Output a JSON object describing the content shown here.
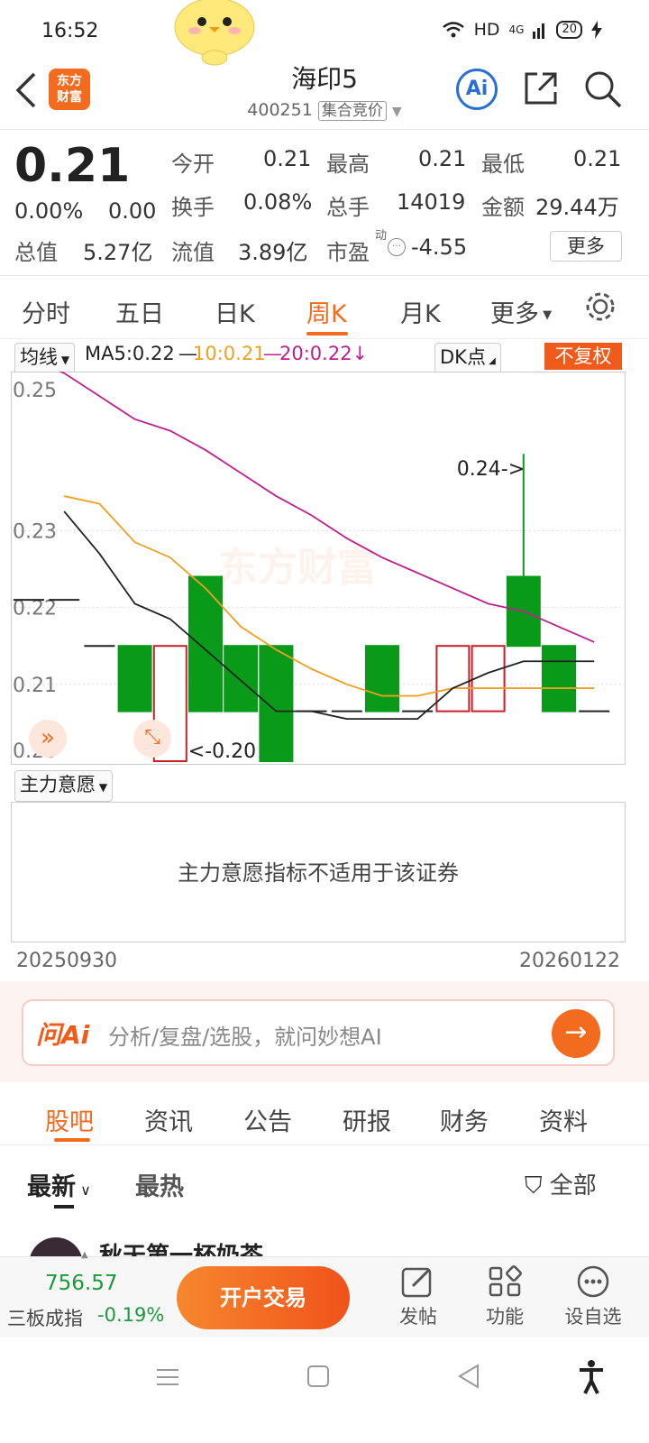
{
  "status": {
    "time": "16:52",
    "hd": "HD",
    "net": "4G",
    "battery": "20"
  },
  "header": {
    "title": "海印5",
    "code": "400251",
    "auction": "集合竞价",
    "logo_line1": "东方",
    "logo_line2": "财富",
    "ai_label": "Ai"
  },
  "quote": {
    "price": "0.21",
    "change_pct": "0.00%",
    "change": "0.00",
    "open_label": "今开",
    "open": "0.21",
    "high_label": "最高",
    "high": "0.21",
    "low_label": "最低",
    "low": "0.21",
    "turnover_label": "换手",
    "turnover": "0.08%",
    "volume_label": "总手",
    "volume": "14019",
    "amount_label": "金额",
    "amount": "29.44万",
    "mcap_label": "总值",
    "mcap": "5.27亿",
    "float_label": "流值",
    "float_cap": "3.89亿",
    "pe_label": "市盈",
    "pe_sup": "动",
    "pe": "-4.55",
    "more": "更多"
  },
  "tabs": [
    "分时",
    "五日",
    "日K",
    "周K",
    "月K",
    "更多"
  ],
  "active_tab": "周K",
  "ma": {
    "selector": "均线",
    "ma5": "MA5:0.22",
    "ma10": "10:0.21",
    "ma20": "20:0.22↓",
    "dk": "DK点",
    "adjust": "不复权",
    "color_ma5": "#222222",
    "color_ma10": "#f0a020",
    "color_ma20": "#c0208f"
  },
  "chart_data": {
    "type": "candlestick",
    "ylim": [
      0.2,
      0.25
    ],
    "ticks": [
      "0.25",
      "0.23",
      "0.22",
      "0.21",
      "0.20"
    ],
    "watermark": "东方财富",
    "max_label": "0.24->",
    "min_label": "<-0.20",
    "candles": [
      {
        "o": 0.221,
        "h": 0.221,
        "l": 0.221,
        "c": 0.221
      },
      {
        "o": 0.221,
        "h": 0.221,
        "l": 0.221,
        "c": 0.221
      },
      {
        "o": 0.215,
        "h": 0.215,
        "l": 0.215,
        "c": 0.215
      },
      {
        "o": 0.215,
        "h": 0.215,
        "l": 0.2065,
        "c": 0.2065
      },
      {
        "o": 0.2,
        "h": 0.215,
        "l": 0.2,
        "c": 0.215
      },
      {
        "o": 0.224,
        "h": 0.224,
        "l": 0.2065,
        "c": 0.2065
      },
      {
        "o": 0.215,
        "h": 0.215,
        "l": 0.2065,
        "c": 0.2065
      },
      {
        "o": 0.215,
        "h": 0.215,
        "l": 0.2,
        "c": 0.2
      },
      {
        "o": 0.2065,
        "h": 0.2065,
        "l": 0.2065,
        "c": 0.2065
      },
      {
        "o": 0.2065,
        "h": 0.2065,
        "l": 0.2065,
        "c": 0.2065
      },
      {
        "o": 0.215,
        "h": 0.215,
        "l": 0.2065,
        "c": 0.2065
      },
      {
        "o": 0.2065,
        "h": 0.2065,
        "l": 0.2065,
        "c": 0.2065
      },
      {
        "o": 0.2065,
        "h": 0.215,
        "l": 0.2065,
        "c": 0.215
      },
      {
        "o": 0.2065,
        "h": 0.215,
        "l": 0.2065,
        "c": 0.215
      },
      {
        "o": 0.224,
        "h": 0.24,
        "l": 0.215,
        "c": 0.215
      },
      {
        "o": 0.215,
        "h": 0.215,
        "l": 0.2065,
        "c": 0.2065
      },
      {
        "o": 0.2065,
        "h": 0.2065,
        "l": 0.2065,
        "c": 0.2065
      }
    ],
    "ma5": [
      null,
      0.2325,
      0.227,
      0.2205,
      0.2185,
      0.2145,
      0.2105,
      0.2065,
      0.2065,
      0.2055,
      0.2055,
      0.2055,
      0.2095,
      0.2115,
      0.213,
      0.213,
      0.213
    ],
    "ma10": [
      null,
      0.2345,
      0.2335,
      0.2285,
      0.2265,
      0.2225,
      0.2175,
      0.2145,
      0.212,
      0.21,
      0.2085,
      0.2085,
      0.2095,
      0.2095,
      0.2095,
      0.2095,
      0.2095
    ],
    "ma20": [
      0.2525,
      0.2505,
      0.2475,
      0.2445,
      0.243,
      0.2405,
      0.2375,
      0.2345,
      0.232,
      0.229,
      0.2265,
      0.2245,
      0.2225,
      0.2205,
      0.2195,
      0.2175,
      0.2155
    ],
    "dates": [
      "20250930",
      "20260122"
    ]
  },
  "indicator": {
    "selector": "主力意愿",
    "message": "主力意愿指标不适用于该证券"
  },
  "ai": {
    "brand": "问Ai",
    "placeholder": "分析/复盘/选股，就问妙想AI"
  },
  "bottom_tabs": [
    "股吧",
    "资讯",
    "公告",
    "研报",
    "财务",
    "资料"
  ],
  "feed": {
    "latest": "最新",
    "hot": "最热",
    "filter": "全部",
    "first_post_author": "秋天第一杯奶茶"
  },
  "bottom_nav": {
    "index_value": "756.57",
    "index_name": "三板成指",
    "index_change": "-0.19%",
    "trade": "开户交易",
    "post": "发帖",
    "func": "功能",
    "watch": "设自选"
  }
}
